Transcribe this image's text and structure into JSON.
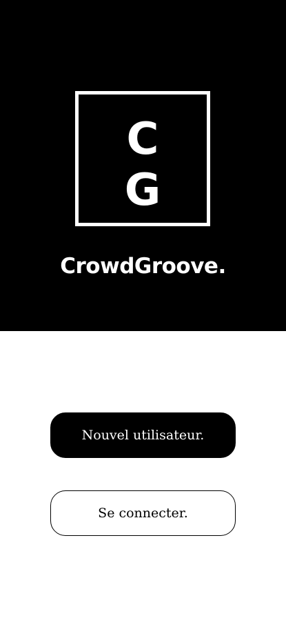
{
  "hero": {
    "logo": {
      "letter_top": "C",
      "letter_bottom": "G"
    },
    "brand_name": "CrowdGroove.",
    "background_color": "#000000",
    "text_color": "#ffffff"
  },
  "actions": {
    "new_user_label": "Nouvel utilisateur.",
    "login_label": "Se connecter."
  }
}
